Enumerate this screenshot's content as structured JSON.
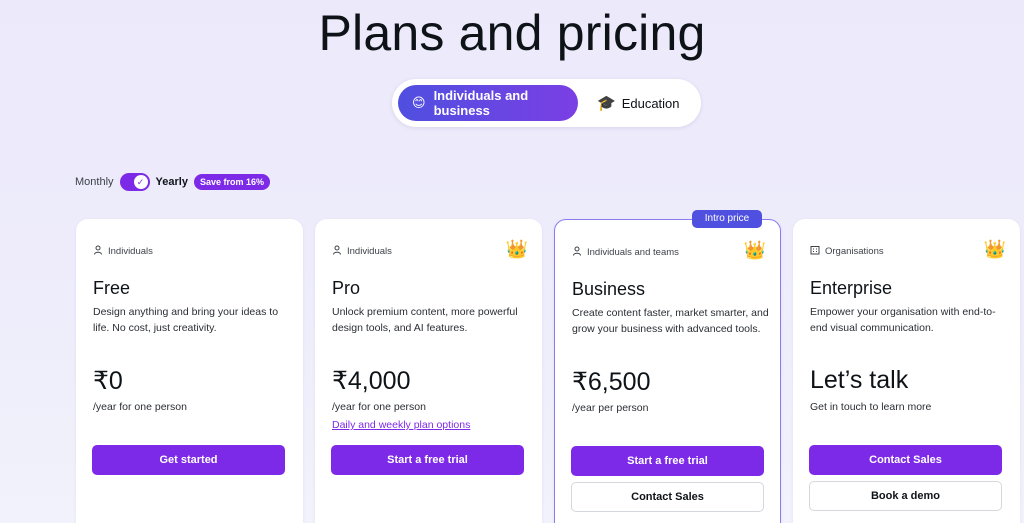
{
  "page": {
    "title": "Plans and pricing"
  },
  "segments": {
    "active": {
      "emoji": "😊",
      "label": "Individuals and business"
    },
    "other": {
      "emoji": "🎓",
      "label": "Education"
    }
  },
  "billing": {
    "monthly_label": "Monthly",
    "yearly_label": "Yearly",
    "toggle_state": "yearly",
    "save_badge": "Save from 16%"
  },
  "colors": {
    "accent": "#7d2ae8",
    "accent_blue": "#4f4fe0",
    "background": "#eeedfb"
  },
  "intro_badge": "Intro price",
  "plans": [
    {
      "audience": "Individuals",
      "audience_icon": "person-icon",
      "has_crown": false,
      "name": "Free",
      "description": "Design anything and bring your ideas to life. No cost, just creativity.",
      "price": "₹0",
      "price_sub": "/year for one person",
      "link": "",
      "primary_button": "Get started",
      "secondary_button": ""
    },
    {
      "audience": "Individuals",
      "audience_icon": "person-icon",
      "has_crown": true,
      "name": "Pro",
      "description": "Unlock premium content, more powerful design tools, and AI features.",
      "price": "₹4,000",
      "price_sub": "/year for one person",
      "link": "Daily and weekly plan options",
      "primary_button": "Start a free trial",
      "secondary_button": ""
    },
    {
      "audience": "Individuals and teams",
      "audience_icon": "person-icon",
      "has_crown": true,
      "name": "Business",
      "description": "Create content faster, market smarter, and grow your business with advanced tools.",
      "price": "₹6,500",
      "price_sub": "/year per person",
      "link": "",
      "primary_button": "Start a free trial",
      "secondary_button": "Contact Sales"
    },
    {
      "audience": "Organisations",
      "audience_icon": "building-icon",
      "has_crown": true,
      "name": "Enterprise",
      "description": "Empower your organisation with end-to-end visual communication.",
      "price": "Let’s talk",
      "price_sub": "Get in touch to learn more",
      "link": "",
      "primary_button": "Contact Sales",
      "secondary_button": "Book a demo"
    }
  ]
}
